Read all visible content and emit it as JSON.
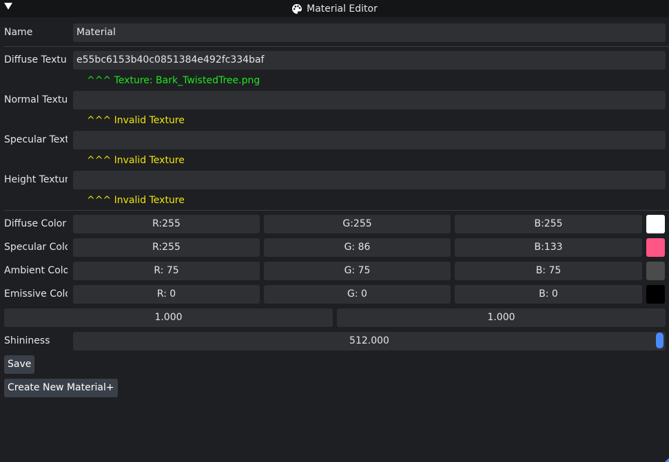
{
  "window": {
    "title": "Material Editor"
  },
  "name": {
    "label": "Name",
    "value": "Material"
  },
  "textures": [
    {
      "label": "Diffuse Textu",
      "value": "e55bc6153b40c0851384e492fc334baf",
      "status": "^^^ Texture: Bark_TwistedTree.png"
    },
    {
      "label": "Normal Textu",
      "value": "",
      "status": "^^^ Invalid Texture"
    },
    {
      "label": "Specular Text",
      "value": "",
      "status": "^^^ Invalid Texture"
    },
    {
      "label": "Height Textur",
      "value": "",
      "status": "^^^ Invalid Texture"
    }
  ],
  "colors": [
    {
      "label": "Diffuse Color",
      "r": "R:255",
      "g": "G:255",
      "b": "B:255",
      "swatch": "#ffffff"
    },
    {
      "label": "Specular Colo",
      "r": "R:255",
      "g": "G: 86",
      "b": "B:133",
      "swatch": "#ff5685"
    },
    {
      "label": "Ambient Colo",
      "r": "R: 75",
      "g": "G: 75",
      "b": "B: 75",
      "swatch": "#4b4b4b"
    },
    {
      "label": "Emissive Colo",
      "r": "R:  0",
      "g": "G:  0",
      "b": "B:  0",
      "swatch": "#000000"
    }
  ],
  "scale": {
    "a": "1.000",
    "b": "1.000"
  },
  "shininess": {
    "label": "Shininess",
    "value": "512.000",
    "fraction": 1.0
  },
  "buttons": {
    "save": "Save",
    "create": "Create New Material+"
  },
  "theme": {
    "ok_color": "#1ee61e",
    "warn_color": "#f0e40a",
    "accent": "#4a8cff"
  }
}
